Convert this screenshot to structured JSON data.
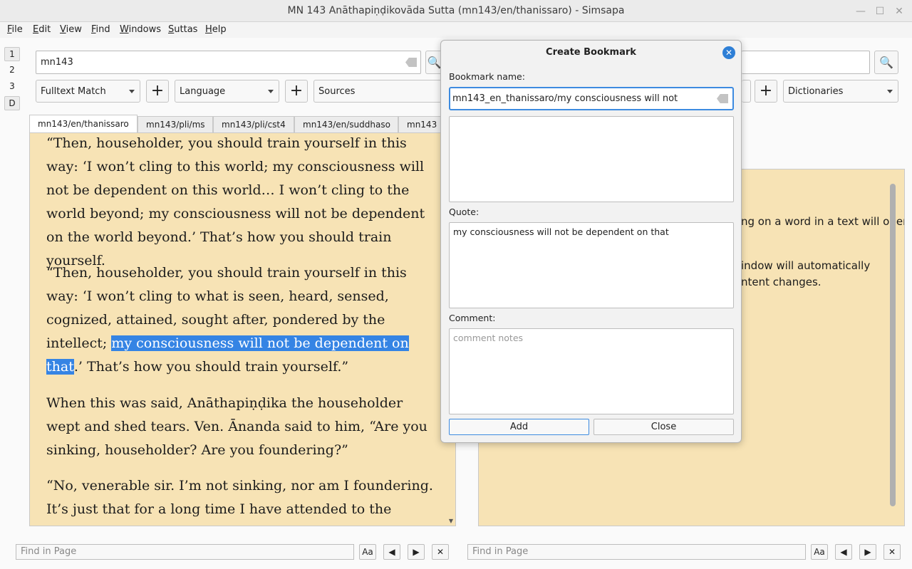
{
  "window": {
    "title": "MN 143 Anāthapiṇḍikovāda Sutta (mn143/en/thanissaro) - Simsapa",
    "minimize_label": "—",
    "maximize_label": "☐",
    "close_label": "✕"
  },
  "menu": [
    "File",
    "Edit",
    "View",
    "Find",
    "Windows",
    "Suttas",
    "Help"
  ],
  "side_tabs": [
    "1",
    "2",
    "3",
    "D"
  ],
  "left_panel": {
    "search_value": "mn143",
    "search_mode": "Fulltext Match",
    "language": "Language",
    "sources": "Sources",
    "tabs": [
      "mn143/en/thanissaro",
      "mn143/pli/ms",
      "mn143/pli/cst4",
      "mn143/en/suddhaso",
      "mn143"
    ],
    "paragraphs": [
      {
        "before": "“Then, householder, you should train yourself in this way: ‘I won’t cling to this world; my consciousness will not be dependent on this world… I won’t cling to the world beyond; my consciousness will not be dependent on the world beyond.’ That’s how you should train yourself.",
        "selected": "",
        "after": ""
      },
      {
        "before": "“Then, householder, you should train yourself in this way: ‘I won’t cling to what is seen, heard, sensed, cognized, attained, sought after, pondered by the intellect; ",
        "selected": "my consciousness will not be dependent on that",
        "after": ".’ That’s how you should train yourself.”"
      },
      {
        "before": "When this was said, Anāthapiṇḍika the householder wept and shed tears. Ven. Ānanda said to him, “Are you sinking, householder? Are you foundering?”",
        "selected": "",
        "after": ""
      },
      {
        "before": "“No, venerable sir. I’m not sinking, nor am I foundering. It’s just that for a long time I have attended to the Teacher, and",
        "selected": "",
        "after": ""
      }
    ],
    "find_placeholder": "Find in Page"
  },
  "right_panel": {
    "dictionaries": "Dictionaries",
    "text_lines": [
      "ng on a word in a text will open",
      "indow will automatically",
      "ntent changes."
    ],
    "find_placeholder": "Find in Page"
  },
  "find_controls": {
    "case_label": "Aa",
    "prev_label": "◀",
    "next_label": "▶",
    "close_label": "✕"
  },
  "dialog": {
    "title": "Create Bookmark",
    "name_label": "Bookmark name:",
    "name_value": "mn143_en_thanissaro/my consciousness will not",
    "quote_label": "Quote:",
    "quote_value": "my consciousness will not be dependent on that",
    "comment_label": "Comment:",
    "comment_placeholder": "comment notes",
    "add_label": "Add",
    "close_label": "Close"
  },
  "colors": {
    "accent": "#3584e4",
    "page_bg": "#f7e3b5"
  }
}
